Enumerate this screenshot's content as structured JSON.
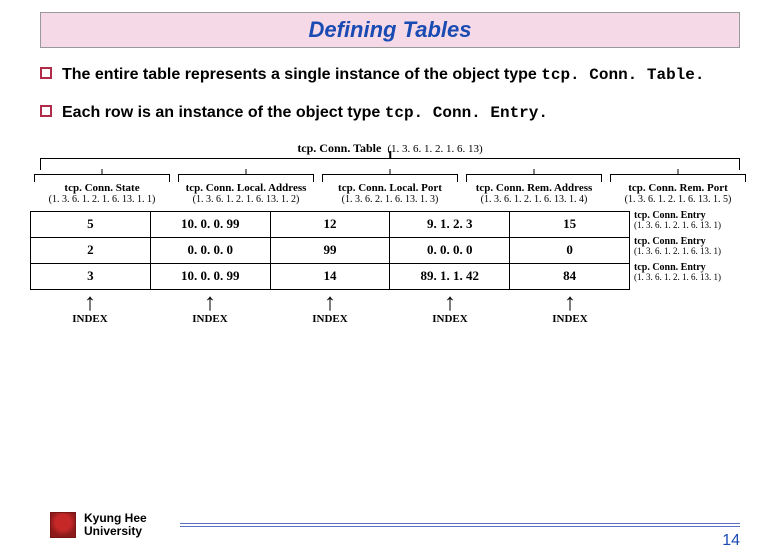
{
  "title": "Defining Tables",
  "bullets": [
    {
      "pre": "The entire table represents a single instance of the object type ",
      "code": "tcp. Conn. Table."
    },
    {
      "pre": "Each row is an instance of the object type ",
      "code": "tcp. Conn. Entry."
    }
  ],
  "top": {
    "name": "tcp. Conn. Table",
    "oid": "(1. 3. 6. 1. 2. 1. 6. 13)"
  },
  "columns": [
    {
      "name": "tcp. Conn. State",
      "oid": "(1. 3. 6. 1. 2. 1. 6. 13. 1. 1)"
    },
    {
      "name": "tcp. Conn. Local. Address",
      "oid": "(1. 3. 6. 1. 2. 1. 6. 13. 1. 2)"
    },
    {
      "name": "tcp. Conn. Local. Port",
      "oid": "(1. 3. 6. 2. 1. 6. 13. 1. 3)"
    },
    {
      "name": "tcp. Conn. Rem. Address",
      "oid": "(1. 3. 6. 1. 2. 1. 6. 13. 1. 4)"
    },
    {
      "name": "tcp. Conn. Rem. Port",
      "oid": "(1. 3. 6. 1. 2. 1. 6. 13. 1. 5)"
    }
  ],
  "rows": [
    [
      "5",
      "10. 0. 0. 99",
      "12",
      "9. 1. 2. 3",
      "15"
    ],
    [
      "2",
      "0. 0. 0. 0",
      "99",
      "0. 0. 0. 0",
      "0"
    ],
    [
      "3",
      "10. 0. 0. 99",
      "14",
      "89. 1. 1. 42",
      "84"
    ]
  ],
  "entries": [
    {
      "name": "tcp. Conn. Entry",
      "oid": "(1. 3. 6. 1. 2. 1. 6. 13. 1)"
    },
    {
      "name": "tcp. Conn. Entry",
      "oid": "(1. 3. 6. 1. 2. 1. 6. 13. 1)"
    },
    {
      "name": "tcp. Conn. Entry",
      "oid": "(1. 3. 6. 1. 2. 1. 6. 13. 1)"
    }
  ],
  "index_label": "INDEX",
  "footer": {
    "uni1": "Kyung Hee",
    "uni2": "University",
    "page": "14"
  },
  "chart_data": {
    "type": "table",
    "title": "tcp.Conn.Table (1.3.6.1.2.1.6.13)",
    "columns": [
      "tcp.Conn.State",
      "tcp.Conn.Local.Address",
      "tcp.Conn.Local.Port",
      "tcp.Conn.Rem.Address",
      "tcp.Conn.Rem.Port"
    ],
    "column_oids": [
      "1.3.6.1.2.1.6.13.1.1",
      "1.3.6.1.2.1.6.13.1.2",
      "1.3.6.2.1.6.13.1.3",
      "1.3.6.1.2.1.6.13.1.4",
      "1.3.6.1.2.1.6.13.1.5"
    ],
    "rows": [
      [
        5,
        "10.0.0.99",
        12,
        "9.1.2.3",
        15
      ],
      [
        2,
        "0.0.0.0",
        99,
        "0.0.0.0",
        0
      ],
      [
        3,
        "10.0.0.99",
        14,
        "89.1.1.42",
        84
      ]
    ],
    "row_entry_oid": "1.3.6.1.2.1.6.13.1",
    "index_columns": [
      "tcp.Conn.State",
      "tcp.Conn.Local.Address",
      "tcp.Conn.Local.Port",
      "tcp.Conn.Rem.Address",
      "tcp.Conn.Rem.Port"
    ]
  }
}
